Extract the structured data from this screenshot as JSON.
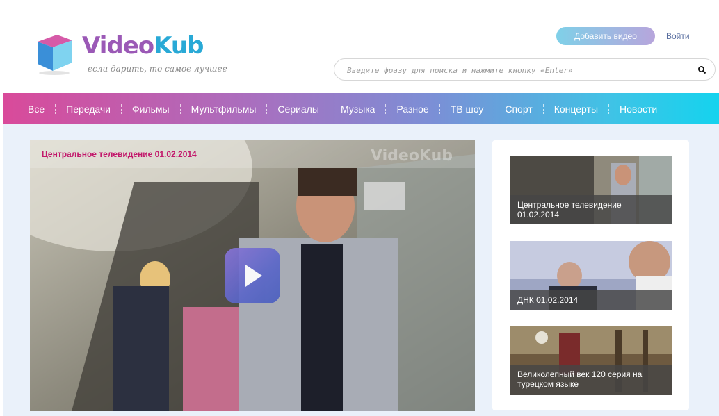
{
  "logo": {
    "brand_main": "Video",
    "brand_accent": "Kub",
    "slogan": "если дарить, то самое лучшее"
  },
  "header": {
    "add_video_label": "Добавить видео",
    "login_label": "Войти"
  },
  "search": {
    "placeholder": "Введите фразу для поиска и нажмите кнопку «Enter»",
    "value": ""
  },
  "nav": {
    "items": [
      "Все",
      "Передачи",
      "Фильмы",
      "Мультфильмы",
      "Сериалы",
      "Музыка",
      "Разное",
      "ТВ шоу",
      "Спорт",
      "Концерты",
      "Новости"
    ]
  },
  "player": {
    "title": "Центральное телевидение 01.02.2014",
    "watermark": "VideoKub"
  },
  "sidebar": {
    "videos": [
      {
        "title": "Центральное телевидение 01.02.2014"
      },
      {
        "title": "ДНК 01.02.2014"
      },
      {
        "title": "Великолепный век 120 серия на турецком языке"
      }
    ]
  },
  "colors": {
    "accent_pink": "#d94a9a",
    "accent_cyan": "#15d3ee",
    "title_magenta": "#c2186b",
    "logo_purple": "#9b59b6"
  }
}
